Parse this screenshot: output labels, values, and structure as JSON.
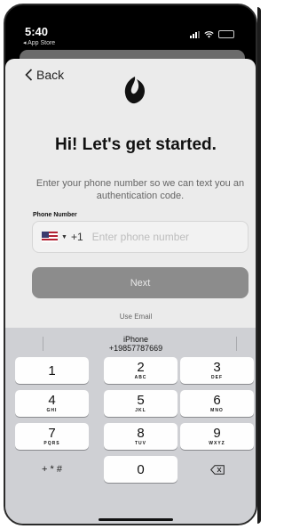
{
  "status_bar": {
    "time": "5:40",
    "back_app": "◂ App Store"
  },
  "nav": {
    "back_label": "Back"
  },
  "content": {
    "heading": "Hi! Let's get started.",
    "subtext": "Enter your phone number so we can text you an authentication code.",
    "phone_label": "Phone Number",
    "country_code": "+1",
    "phone_placeholder": "Enter phone number",
    "next_label": "Next",
    "use_email_label": "Use Email"
  },
  "keyboard": {
    "suggestion_title": "iPhone",
    "suggestion_number": "+19857787669",
    "keys": [
      {
        "num": "1",
        "letters": ""
      },
      {
        "num": "2",
        "letters": "ABC"
      },
      {
        "num": "3",
        "letters": "DEF"
      },
      {
        "num": "4",
        "letters": "GHI"
      },
      {
        "num": "5",
        "letters": "JKL"
      },
      {
        "num": "6",
        "letters": "MNO"
      },
      {
        "num": "7",
        "letters": "PQRS"
      },
      {
        "num": "8",
        "letters": "TUV"
      },
      {
        "num": "9",
        "letters": "WXYZ"
      },
      {
        "num": "0",
        "letters": ""
      }
    ],
    "symbols_label": "+ * #"
  },
  "colors": {
    "next_button": "#8c8c8c",
    "sheet_background": "#ebebeb",
    "keyboard_background": "#cfd0d4"
  }
}
